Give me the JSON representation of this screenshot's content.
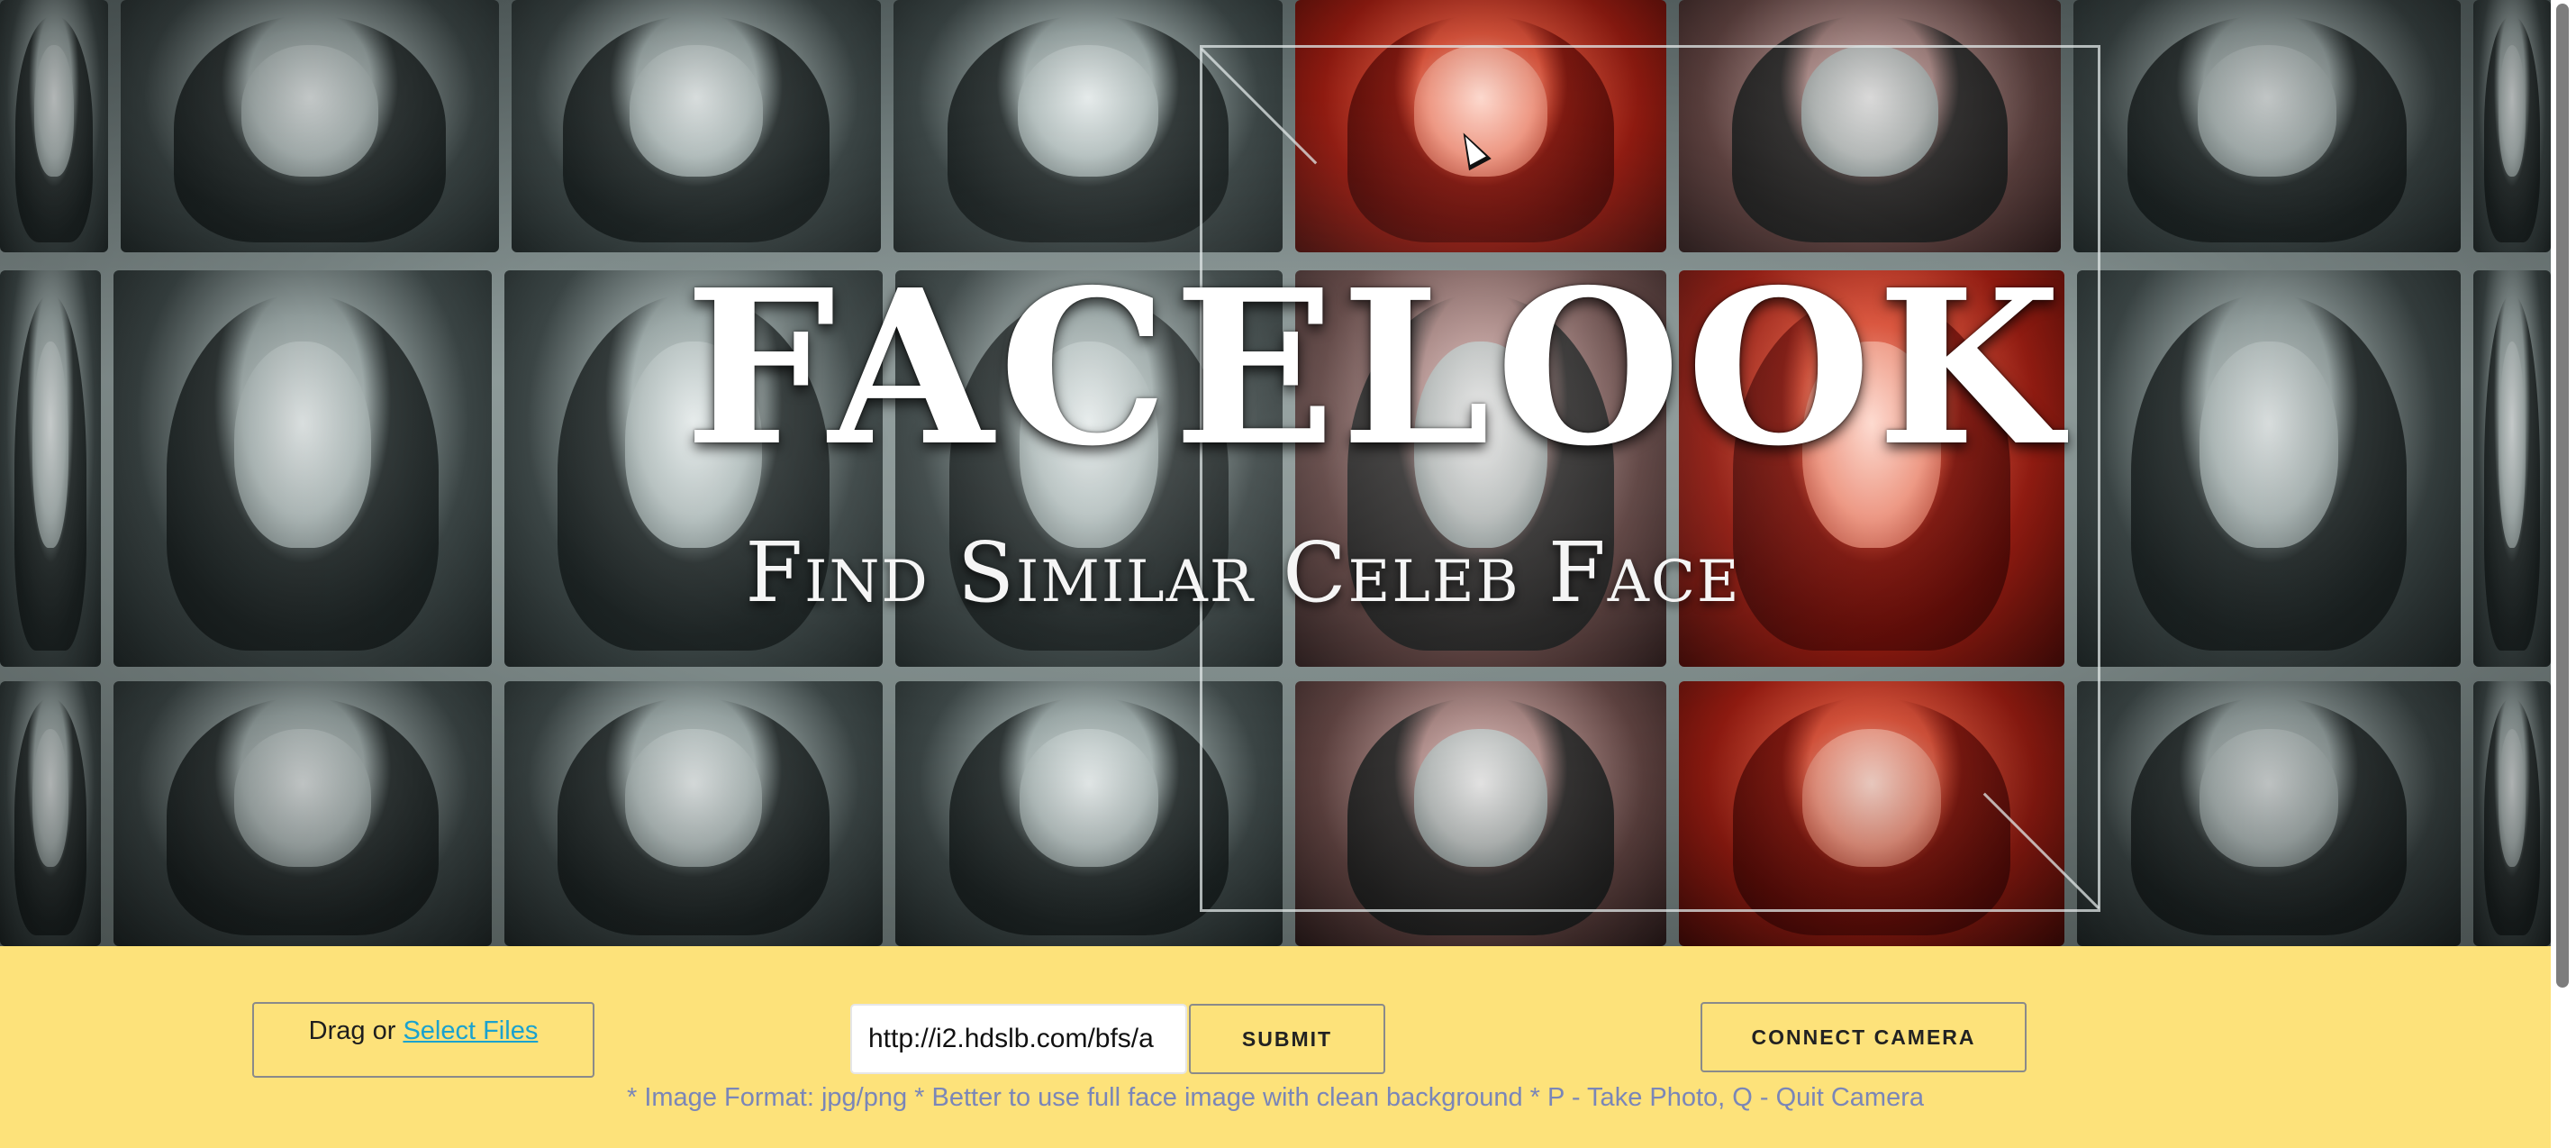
{
  "hero": {
    "title": "FACELOOK",
    "subtitle": "Find Similar Celeb Face"
  },
  "upload": {
    "drag_text": "Drag or",
    "select_link": "Select Files"
  },
  "url_input": {
    "value": "http://i2.hdslb.com/bfs/a"
  },
  "buttons": {
    "submit": "SUBMIT",
    "connect_camera": "CONNECT CAMERA"
  },
  "hint": "* Image Format: jpg/png * Better to use full face image with clean background * P - Take Photo, Q - Quit Camera",
  "colors": {
    "panel_background": "#fde27a",
    "link": "#1aa2cf",
    "hint_text": "#7a86b8",
    "hero_accent_red": "#d9543c"
  },
  "icons": {
    "cursor": "mouse-pointer-icon"
  }
}
